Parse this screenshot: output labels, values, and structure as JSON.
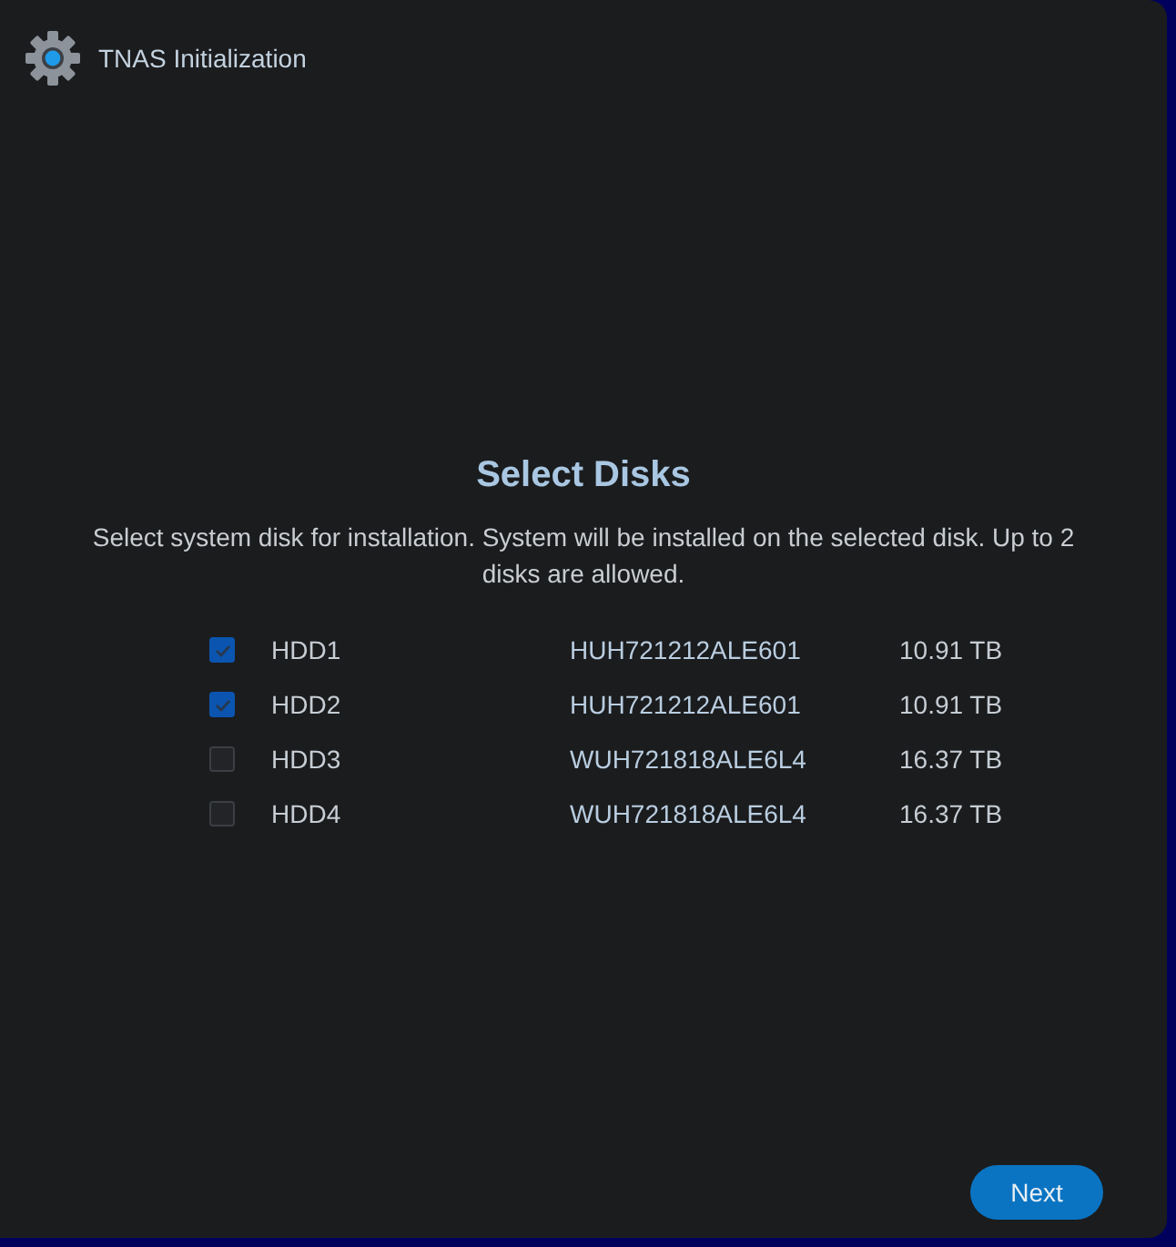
{
  "window": {
    "title": "TNAS Initialization"
  },
  "heading": "Select Disks",
  "description": "Select system disk for installation. System will be installed on the selected disk. Up to 2 disks are allowed.",
  "disks": [
    {
      "name": "HDD1",
      "model": "HUH721212ALE601",
      "size": "10.91 TB",
      "checked": true
    },
    {
      "name": "HDD2",
      "model": "HUH721212ALE601",
      "size": "10.91 TB",
      "checked": true
    },
    {
      "name": "HDD3",
      "model": "WUH721818ALE6L4",
      "size": "16.37 TB",
      "checked": false
    },
    {
      "name": "HDD4",
      "model": "WUH721818ALE6L4",
      "size": "16.37 TB",
      "checked": false
    }
  ],
  "buttons": [
    {
      "label": "Next"
    }
  ]
}
